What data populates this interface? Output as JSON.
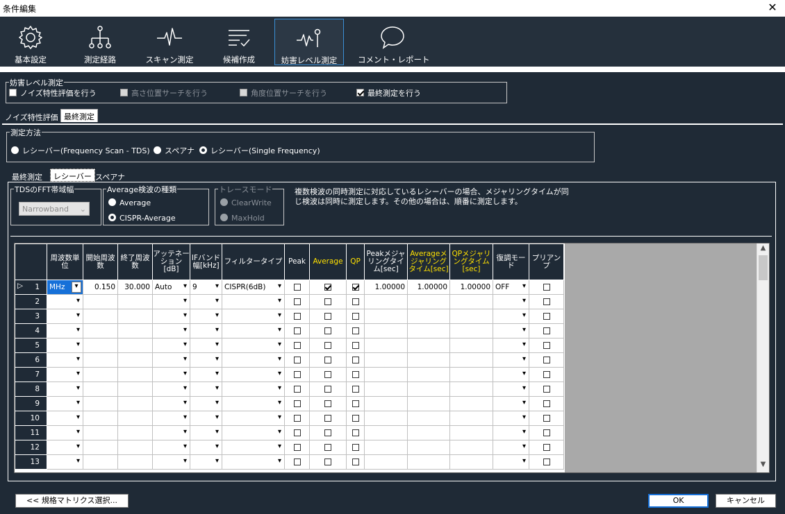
{
  "window": {
    "title": "条件編集",
    "close": "✕"
  },
  "toolbar": [
    {
      "label": "基本設定",
      "icon": "gear-icon"
    },
    {
      "label": "測定経路",
      "icon": "tree-icon"
    },
    {
      "label": "スキャン測定",
      "icon": "pulse-icon"
    },
    {
      "label": "候補作成",
      "icon": "list-check-icon"
    },
    {
      "label": "妨害レベル測定",
      "icon": "signal-probe-icon"
    },
    {
      "label": "コメント・レポート",
      "icon": "speech-bubble-icon"
    }
  ],
  "interference": {
    "title": "妨害レベル測定",
    "noise_eval": "ノイズ特性評価を行う",
    "height_search": "高さ位置サーチを行う",
    "angle_search": "角度位置サーチを行う",
    "final_measure": "最終測定を行う"
  },
  "tabs_top": [
    "ノイズ特性評価",
    "最終測定"
  ],
  "method": {
    "title": "測定方法",
    "opt1": "レシーバー(Frequency Scan - TDS)",
    "opt2": "スペアナ",
    "opt3": "レシーバー(Single Frequency)"
  },
  "tabs_inner": [
    "最終測定",
    "レシーバー",
    "スペアナ"
  ],
  "fft": {
    "title": "TDSのFFT帯域幅",
    "value": "Narrowband"
  },
  "average": {
    "title": "Average検波の種類",
    "opt1": "Average",
    "opt2": "CISPR-Average"
  },
  "trace": {
    "title": "トレースモード",
    "opt1": "ClearWrite",
    "opt2": "MaxHold"
  },
  "note": "複数検波の同時測定に対応しているレシーバーの場合、メジャリングタイムが同じ検波は同時に測定します。その他の場合は、順番に測定します。",
  "grid": {
    "headers": {
      "unit": "周波数単位",
      "start": "開始周波数",
      "end": "終了周波数",
      "att": "アッテネーション[dB]",
      "ifbw": "IFバンド幅[kHz]",
      "filter": "フィルタータイプ",
      "peak": "Peak",
      "avg": "Average",
      "qp": "QP",
      "peak_time": "Peakメジャリングタイム[sec]",
      "avg_time": "Averageメジャリングタイム[sec]",
      "qp_time": "QPメジャリングタイム[sec]",
      "demod": "復調モード",
      "preamp": "プリアンプ"
    },
    "row1": {
      "num": "1",
      "unit": "MHz",
      "start": "0.150",
      "end": "30.000",
      "att": "Auto",
      "ifbw": "9",
      "filter": "CISPR(6dB)",
      "peak_time": "1.00000",
      "avg_time": "1.00000",
      "qp_time": "1.00000",
      "demod": "OFF"
    },
    "rows": [
      "2",
      "3",
      "4",
      "5",
      "6",
      "7",
      "8",
      "9",
      "10",
      "11",
      "12",
      "13"
    ]
  },
  "buttons": {
    "matrix": "<< 規格マトリクス選択...",
    "ok": "OK",
    "cancel": "キャンセル"
  }
}
